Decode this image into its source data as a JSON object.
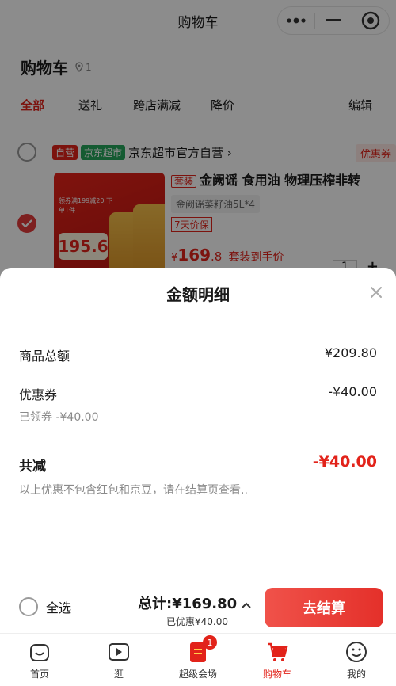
{
  "topbar": {
    "title": "购物车"
  },
  "cart": {
    "heading": "购物车",
    "location_count": "1",
    "tabs": [
      "全部",
      "送礼",
      "跨店满减",
      "降价"
    ],
    "edit_label": "编辑",
    "store": {
      "self_operated_badge": "自营",
      "market_badge": "京东超市",
      "name": "京东超市官方自营 ›",
      "coupon_label": "优惠券"
    },
    "product": {
      "set_tag": "套装",
      "title": "金阙谣 食用油 物理压榨非转",
      "spec": "金阙谣菜籽油5L*4",
      "price_tag": "7天价保",
      "price_prefix": "¥",
      "price_main": "169",
      "price_decimal": ".8",
      "price_note": "套装到手价",
      "image_price": "195.6",
      "image_promo": "领券满199减20 下单1件",
      "quantity": "1"
    }
  },
  "sheet": {
    "title": "金额明细",
    "rows": [
      {
        "label": "商品总额",
        "value": "¥209.80"
      },
      {
        "label": "优惠券",
        "value": "-¥40.00"
      }
    ],
    "coupon_note": "已领券 -¥40.00",
    "total_label": "共减",
    "total_value": "-¥40.00",
    "disclaimer": "以上优惠不包含红包和京豆，请在结算页查看.."
  },
  "settle": {
    "select_all": "全选",
    "total": "总计:¥169.80",
    "saved": "已优惠¥40.00",
    "checkout": "去结算"
  },
  "tabbar": {
    "items": [
      {
        "label": "首页",
        "icon": "home-icon"
      },
      {
        "label": "逛",
        "icon": "video-icon"
      },
      {
        "label": "超级会场",
        "icon": "venue-icon",
        "badge": "1"
      },
      {
        "label": "购物车",
        "icon": "cart-icon"
      },
      {
        "label": "我的",
        "icon": "profile-icon"
      }
    ]
  },
  "colors": {
    "accent": "#e2231a",
    "checkout_start": "#f0524a",
    "checkout_end": "#e4302a"
  }
}
